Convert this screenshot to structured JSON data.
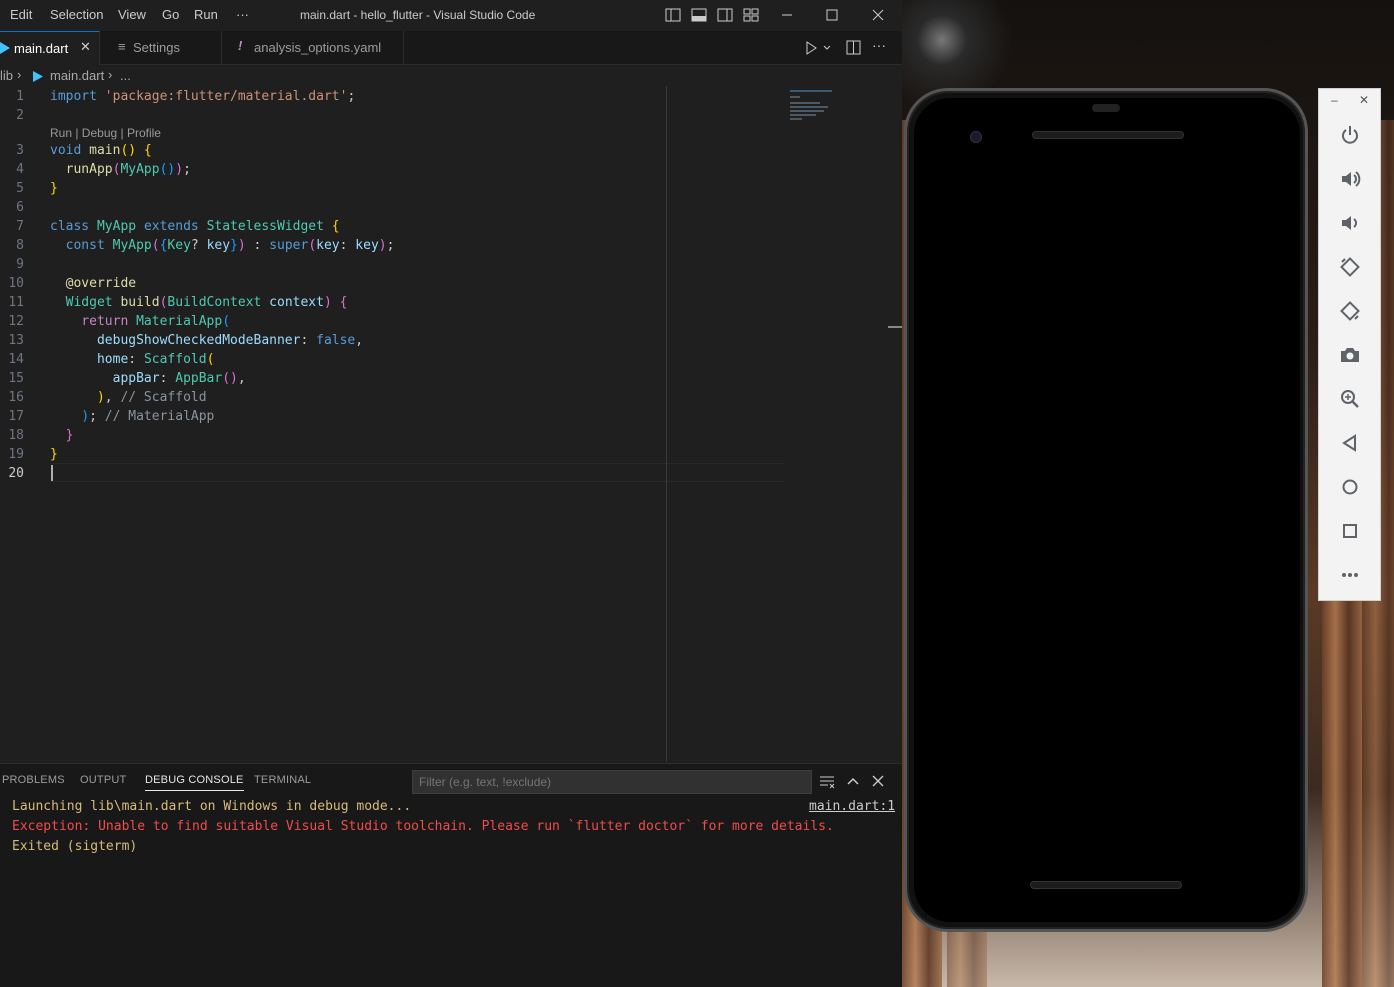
{
  "titlebar": {
    "menu": [
      "Edit",
      "Selection",
      "View",
      "Go",
      "Run",
      "···"
    ],
    "title": "main.dart - hello_flutter - Visual Studio Code"
  },
  "tabs": [
    {
      "label": "main.dart",
      "icon": "dart-icon",
      "active": true
    },
    {
      "label": "Settings",
      "icon": "settings-lines-icon",
      "active": false
    },
    {
      "label": "analysis_options.yaml",
      "icon": "exclamation-icon",
      "active": false
    }
  ],
  "breadcrumb": {
    "folder": "lib",
    "file": "main.dart",
    "more": "..."
  },
  "editor": {
    "codelens": "Run | Debug | Profile",
    "line_numbers": [
      "1",
      "2",
      "3",
      "4",
      "5",
      "6",
      "7",
      "8",
      "9",
      "10",
      "11",
      "12",
      "13",
      "14",
      "15",
      "16",
      "17",
      "18",
      "19",
      "20"
    ],
    "current_line": "20"
  },
  "panel": {
    "tabs": [
      "PROBLEMS",
      "OUTPUT",
      "DEBUG CONSOLE",
      "TERMINAL"
    ],
    "active_tab": "DEBUG CONSOLE",
    "filter_placeholder": "Filter (e.g. text, !exclude)",
    "console": [
      {
        "text": "Launching lib\\main.dart on Windows in debug mode...",
        "color": "#d7ba7d"
      },
      {
        "text": "Exception: Unable to find suitable Visual Studio toolchain. Please run `flutter doctor` for more details.",
        "color": "#f14c4c"
      },
      {
        "text": "Exited (sigterm)",
        "color": "#d7ba7d"
      }
    ],
    "source_link": "main.dart:1"
  },
  "emulator": {
    "controls": [
      "minimize-icon",
      "close-icon"
    ],
    "tools": [
      "power-icon",
      "volume-up-icon",
      "volume-down-icon",
      "rotate-left-icon",
      "rotate-right-icon",
      "camera-icon",
      "zoom-icon",
      "back-icon",
      "home-icon",
      "overview-icon",
      "more-icon"
    ]
  },
  "colors": {
    "accent": "#0078d4",
    "editor_bg": "#1f1f1f",
    "error": "#f14c4c",
    "warning": "#d7ba7d"
  }
}
